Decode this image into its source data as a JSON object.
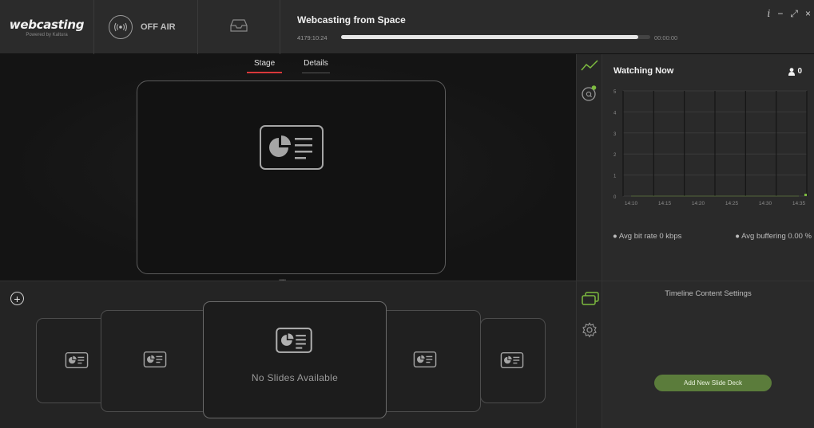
{
  "brand": {
    "name": "webcasting",
    "tagline": "Powered by Kaltura"
  },
  "broadcast": {
    "status_label": "OFF AIR"
  },
  "event": {
    "title": "Webcasting from Space",
    "elapsed": "4179:10:24",
    "progress": 0.96,
    "end_time": "00:00:00"
  },
  "window_controls": {
    "info": "i",
    "minimize": "−",
    "expand": "⤢",
    "close": "×"
  },
  "stage": {
    "tabs": [
      "Stage",
      "Details"
    ],
    "active_tab": "Stage"
  },
  "stats": {
    "title": "Watching Now",
    "viewer_count": "0",
    "avg_bitrate": "● Avg bit rate 0 kbps",
    "avg_buffering": "● Avg buffering 0.00 %",
    "chart_data": {
      "type": "line",
      "title": "Watching Now",
      "x": [
        "14:10",
        "14:15",
        "14:20",
        "14:25",
        "14:30",
        "14:35"
      ],
      "y_ticks": [
        "0",
        "1",
        "2",
        "3",
        "4",
        "5"
      ],
      "ylim": [
        0,
        5
      ],
      "series": [
        {
          "values": [
            0,
            0,
            0,
            0,
            0,
            0
          ]
        }
      ],
      "grid": true,
      "accent": "#7dbb3f"
    }
  },
  "slides": {
    "empty_label": "No Slides Available"
  },
  "timeline": {
    "title": "Timeline Content Settings",
    "add_button": "Add New Slide Deck"
  },
  "colors": {
    "accent_red": "#d9383a",
    "accent_green": "#7dbb3f",
    "button_green": "#5b7c3b"
  },
  "icons": {
    "onair": "broadcast-icon",
    "inbox": "inbox-icon",
    "stats": "line-chart-icon",
    "qa": "chat-question-icon",
    "slides": "slides-icon",
    "settings": "gear-icon",
    "add": "plus-icon"
  }
}
